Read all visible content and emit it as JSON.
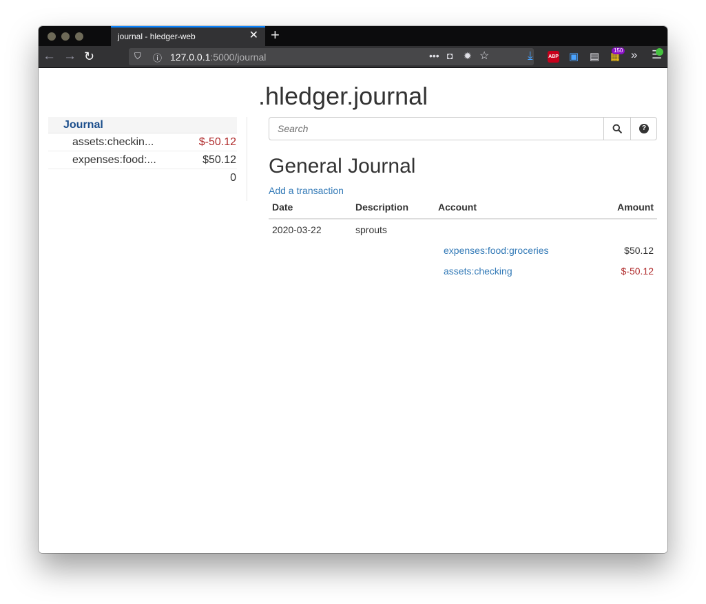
{
  "browser": {
    "tab_title": "journal - hledger-web",
    "tab_close": "✕",
    "new_tab": "+",
    "url_host": "127.0.0.1",
    "url_rest": ":5000/journal",
    "addon_badge": "150",
    "abp_label": "ABP"
  },
  "page": {
    "title": ".hledger.journal"
  },
  "sidebar": {
    "heading": "Journal",
    "accounts": [
      {
        "name": "assets:checkin...",
        "amount": "$-50.12",
        "negative": true
      },
      {
        "name": "expenses:food:...",
        "amount": "$50.12",
        "negative": false
      }
    ],
    "total": "0"
  },
  "search": {
    "placeholder": "Search"
  },
  "main": {
    "heading": "General Journal",
    "add_transaction": "Add a transaction",
    "columns": [
      "Date",
      "Description",
      "Account",
      "Amount"
    ],
    "transaction": {
      "date": "2020-03-22",
      "description": "sprouts",
      "postings": [
        {
          "account": "expenses:food:groceries",
          "amount": "$50.12",
          "negative": false
        },
        {
          "account": "assets:checking",
          "amount": "$-50.12",
          "negative": true
        }
      ]
    }
  },
  "colors": {
    "link": "#337ab7",
    "negative": "#b02b2c",
    "sidebar_heading": "#1b4e8c",
    "tab_accent": "#0a84ff"
  }
}
